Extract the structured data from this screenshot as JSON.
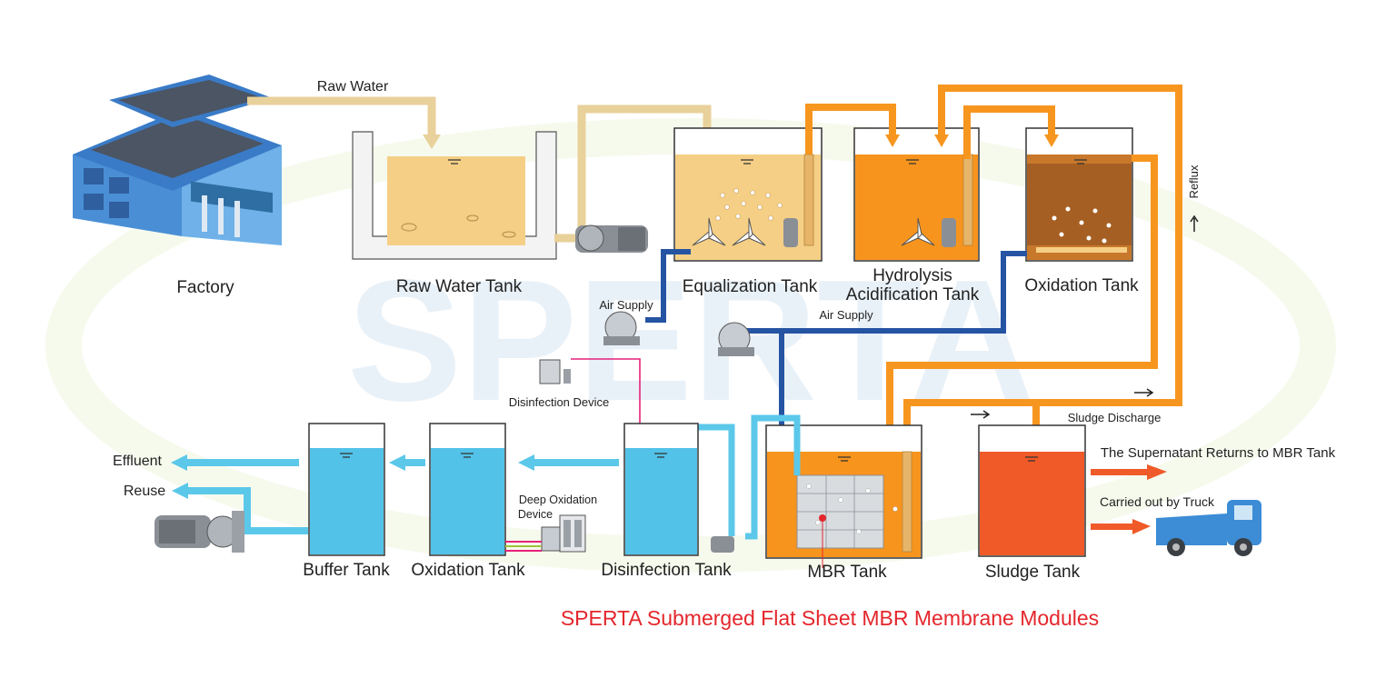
{
  "labels": {
    "factory": "Factory",
    "raw_water": "Raw Water",
    "raw_water_tank": "Raw Water Tank",
    "equalization_tank": "Equalization Tank",
    "hydrolysis_line1": "Hydrolysis",
    "hydrolysis_line2": "Acidification Tank",
    "oxidation_tank_top": "Oxidation Tank",
    "reflux": "Reflux",
    "air_supply_1": "Air Supply",
    "air_supply_2": "Air Supply",
    "disinfection_device": "Disinfection Device",
    "sludge_discharge": "Sludge Discharge",
    "supernatant_returns": "The Supernatant Returns to MBR Tank",
    "carried_by_truck": "Carried out by Truck",
    "effluent": "Effluent",
    "reuse": "Reuse",
    "deep_oxidation_line1": "Deep Oxidation",
    "deep_oxidation_line2": "Device",
    "buffer_tank": "Buffer Tank",
    "oxidation_tank_bottom": "Oxidation Tank",
    "disinfection_tank": "Disinfection Tank",
    "mbr_tank": "MBR Tank",
    "sludge_tank": "Sludge Tank",
    "membrane_caption": "SPERTA Submerged Flat Sheet MBR Membrane Modules",
    "watermark": "SPERTA"
  },
  "colors": {
    "raw_water": "#F5CF85",
    "pipe_raw": "#E8D19A",
    "orange": "#F7941D",
    "orange_pipe": "#F7961F",
    "blue_air": "#2554A3",
    "light_blue": "#5BC8EA",
    "clean_water": "#52C2E8",
    "sludge": "#F05A28",
    "caption_red": "#E4262C",
    "disinfection_line": "#E6217A"
  }
}
